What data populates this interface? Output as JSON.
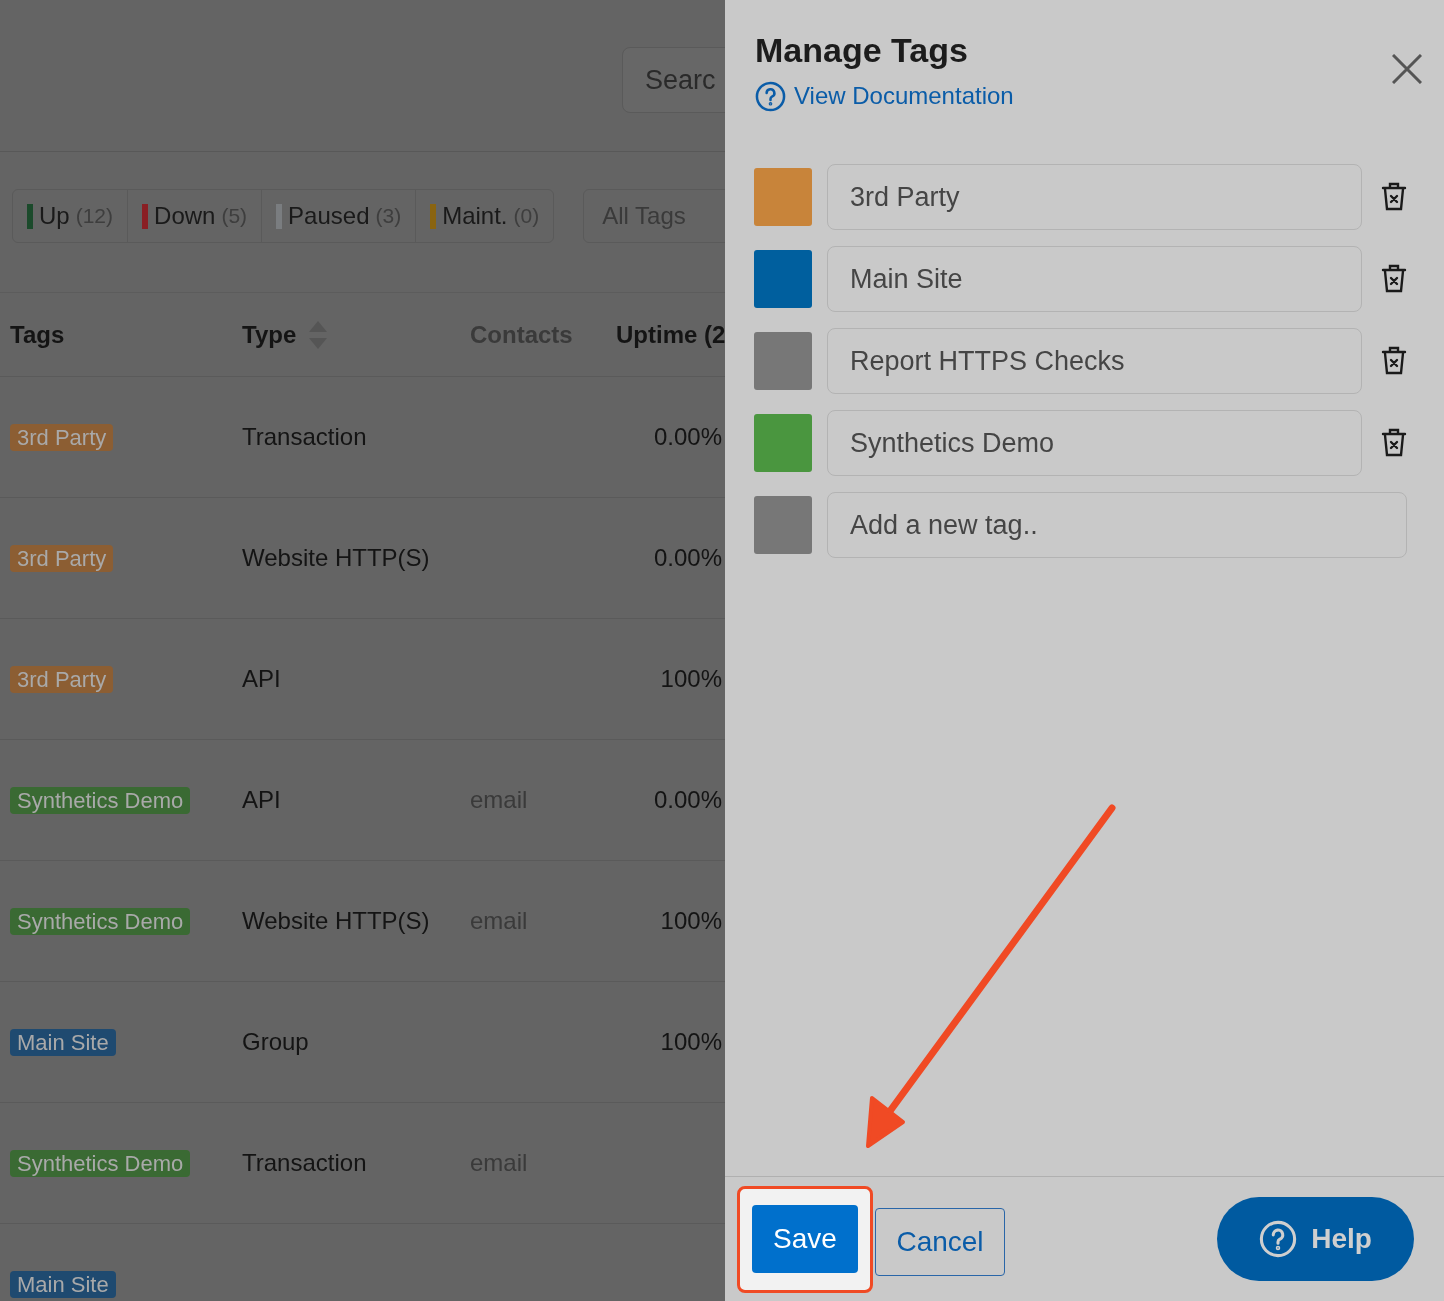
{
  "background": {
    "search": {
      "placeholder": "Searc"
    },
    "status_filters": [
      {
        "label": "Up",
        "count": "(12)",
        "color": "#1b4a2b"
      },
      {
        "label": "Down",
        "count": "(5)",
        "color": "#8a1f24"
      },
      {
        "label": "Paused",
        "count": "(3)",
        "color": "#7a7d80"
      },
      {
        "label": "Maint.",
        "count": "(0)",
        "color": "#8a6410"
      }
    ],
    "tag_filter": {
      "placeholder": "All Tags"
    },
    "table": {
      "columns": [
        {
          "label": "Tags",
          "kind": "plain"
        },
        {
          "label": "Type",
          "kind": "sortable"
        },
        {
          "label": "Contacts",
          "kind": "muted"
        },
        {
          "label": "Uptime (2",
          "kind": "plain"
        }
      ],
      "rows": [
        {
          "tag": {
            "label": "3rd Party",
            "color": "#8c5e33"
          },
          "type": "Transaction",
          "uptime": "0.00%"
        },
        {
          "tag": {
            "label": "3rd Party",
            "color": "#8c5e33"
          },
          "type": "Website HTTP(S)",
          "uptime": "0.00%"
        },
        {
          "tag": {
            "label": "3rd Party",
            "color": "#8c5e33"
          },
          "type": "API",
          "uptime": "100%"
        },
        {
          "tag": {
            "label": "Synthetics Demo",
            "color": "#3a6a33"
          },
          "type": "API",
          "contacts": "email",
          "uptime": "0.00%"
        },
        {
          "tag": {
            "label": "Synthetics Demo",
            "color": "#3a6a33"
          },
          "type": "Website HTTP(S)",
          "contacts": "email",
          "uptime": "100%"
        },
        {
          "tag": {
            "label": "Main Site",
            "color": "#1f4a70"
          },
          "type": "Group",
          "uptime": "100%"
        },
        {
          "tag": {
            "label": "Synthetics Demo",
            "color": "#3a6a33"
          },
          "type": "Transaction",
          "contacts": "email"
        },
        {
          "tag": {
            "label": "Main Site",
            "color": "#1f4a70"
          }
        }
      ]
    }
  },
  "panel": {
    "title": "Manage Tags",
    "doc_link": "View Documentation",
    "tags": [
      {
        "value": "3rd Party",
        "color": "#c8843a"
      },
      {
        "value": "Main Site",
        "color": "#005f9e"
      },
      {
        "value": "Report HTTPS Checks",
        "color": "#777777"
      },
      {
        "value": "Synthetics Demo",
        "color": "#4a963f"
      }
    ],
    "new_tag": {
      "placeholder": "Add a new tag..",
      "color": "#777777"
    },
    "buttons": {
      "save": "Save",
      "cancel": "Cancel"
    },
    "help": "Help"
  }
}
